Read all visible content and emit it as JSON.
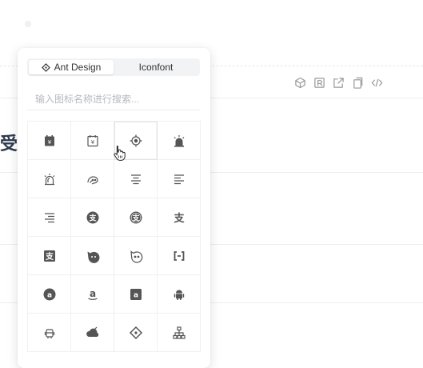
{
  "background": {
    "partial_heading": "受",
    "toolbar_icons": [
      "codesandbox-icon",
      "codepen-icon",
      "external-link-icon",
      "copy-icon",
      "code-icon"
    ]
  },
  "icon_picker": {
    "tabs": [
      {
        "label": "Ant Design",
        "icon": "ant-design-icon",
        "active": true
      },
      {
        "label": "Iconfont",
        "active": false
      }
    ],
    "search": {
      "placeholder": "输入图标名称进行搜索...",
      "value": ""
    },
    "icons": [
      "account-book-icon",
      "account-book-outlined-icon",
      "aim-icon",
      "alert-icon",
      "alert-outlined-icon",
      "aliwangwang-icon",
      "align-center-icon",
      "align-left-icon",
      "align-right-icon",
      "alipay-circle-icon",
      "alipay-circle-outlined-icon",
      "alipay-icon",
      "alipay-square-icon",
      "aliwangwang-filled-icon",
      "aliwangwang-outlined-icon",
      "aliyun-icon",
      "amazon-circle-icon",
      "amazon-icon",
      "amazon-square-icon",
      "android-icon",
      "android-outlined-icon",
      "ant-cloud-icon",
      "ant-design-icon",
      "apartment-icon"
    ],
    "hovered_icon": "aim-icon"
  }
}
